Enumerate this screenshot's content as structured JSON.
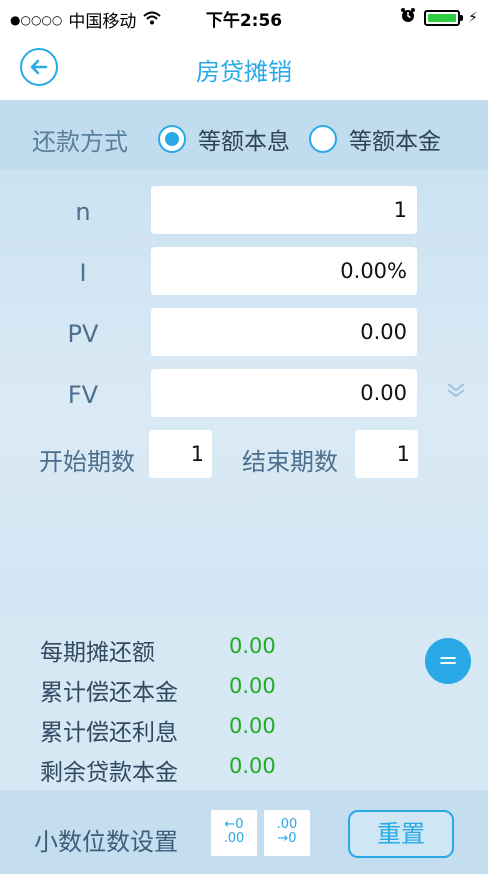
{
  "status_bar": {
    "signal": "●○○○○",
    "carrier": "中国移动",
    "wifi_icon": "wifi-icon",
    "time": "下午2:56",
    "alarm_icon": "alarm-icon",
    "battery_icon": "battery-icon",
    "battery_level": 1.0
  },
  "nav": {
    "back_icon": "arrow-left-circle-icon",
    "title": "房贷摊销"
  },
  "repay_method": {
    "label": "还款方式",
    "options": [
      {
        "label": "等额本息",
        "selected": true
      },
      {
        "label": "等额本金",
        "selected": false
      }
    ]
  },
  "fields": [
    {
      "label": "n",
      "value": "1"
    },
    {
      "label": "I",
      "value": "0.00%"
    },
    {
      "label": "PV",
      "value": "0.00"
    },
    {
      "label": "FV",
      "value": "0.00"
    }
  ],
  "expand_icon": "chevron-double-down-icon",
  "periods": {
    "start_label": "开始期数",
    "start_value": "1",
    "end_label": "结束期数",
    "end_value": "1"
  },
  "results": [
    {
      "label": "每期摊还额",
      "value": "0.00"
    },
    {
      "label": "累计偿还本金",
      "value": "0.00"
    },
    {
      "label": "累计偿还利息",
      "value": "0.00"
    },
    {
      "label": "剩余贷款本金",
      "value": "0.00"
    }
  ],
  "equals_button": "=",
  "bottom": {
    "decimal_label": "小数位数设置",
    "decrease_top": "←0",
    "decrease_bottom": ".00",
    "increase_top": ".00",
    "increase_bottom": "→0",
    "reset_label": "重置"
  },
  "colors": {
    "accent": "#29a9e6",
    "result_value": "#22aa22",
    "panel_bg": "#c6e0f0"
  }
}
